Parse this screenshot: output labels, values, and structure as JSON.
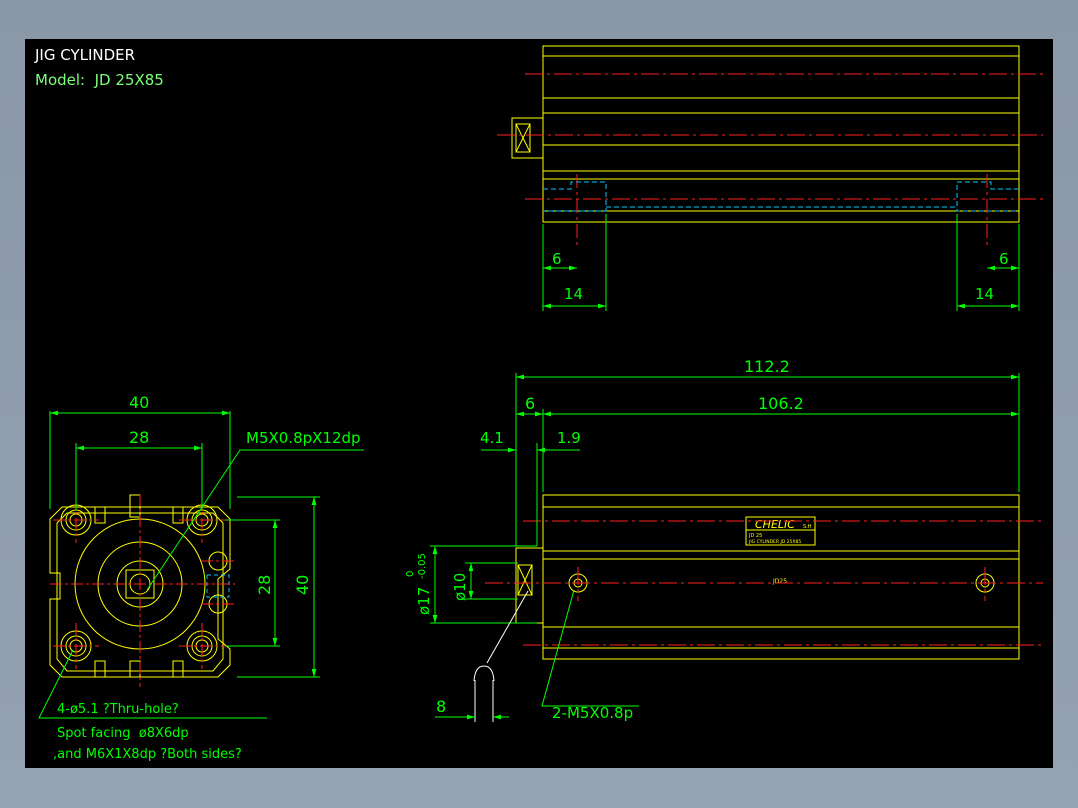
{
  "colors": {
    "background": "#000000",
    "frame": "#8e9bab",
    "outline": "#ffff00",
    "dimension": "#00ff00",
    "centerline": "#ff2020",
    "hidden": "#00c8ff",
    "title": "#ffffff",
    "model": "#7cff7c"
  },
  "title_block": {
    "title": "JIG CYLINDER",
    "model": "Model:  JD 25X85"
  },
  "top_view": {
    "dim_left_small": "6",
    "dim_left_large": "14",
    "dim_right_small": "6",
    "dim_right_large": "14"
  },
  "end_view": {
    "width_outer": "40",
    "width_inner": "28",
    "thread_callout": "M5X0.8pX12dp",
    "height_inner": "28",
    "height_outer": "40",
    "hole_note_line1": "4-ø5.1 ?Thru-hole?",
    "hole_note_line2": "Spot facing  ø8X6dp",
    "hole_note_line3": ",and M6X1X8dp ?Both sides?"
  },
  "side_view": {
    "total_length": "112.2",
    "rod_extension": "6",
    "body_length": "106.2",
    "dim_4_1": "4.1",
    "dim_1_9": "1.9",
    "rod_diameter_main": "ø17",
    "rod_tolerance_upper": "0",
    "rod_tolerance_lower": "-0.05",
    "rod_inner_diameter": "ø10",
    "wrench_flat": "8",
    "port_callout": "2-M5X0.8p",
    "label_brand": "CHELIC",
    "label_suffix": "S.H",
    "label_line1": "JD 25",
    "label_line2": "JIG CYLINDER  JD 25X85",
    "bore_mark": "JD25"
  }
}
